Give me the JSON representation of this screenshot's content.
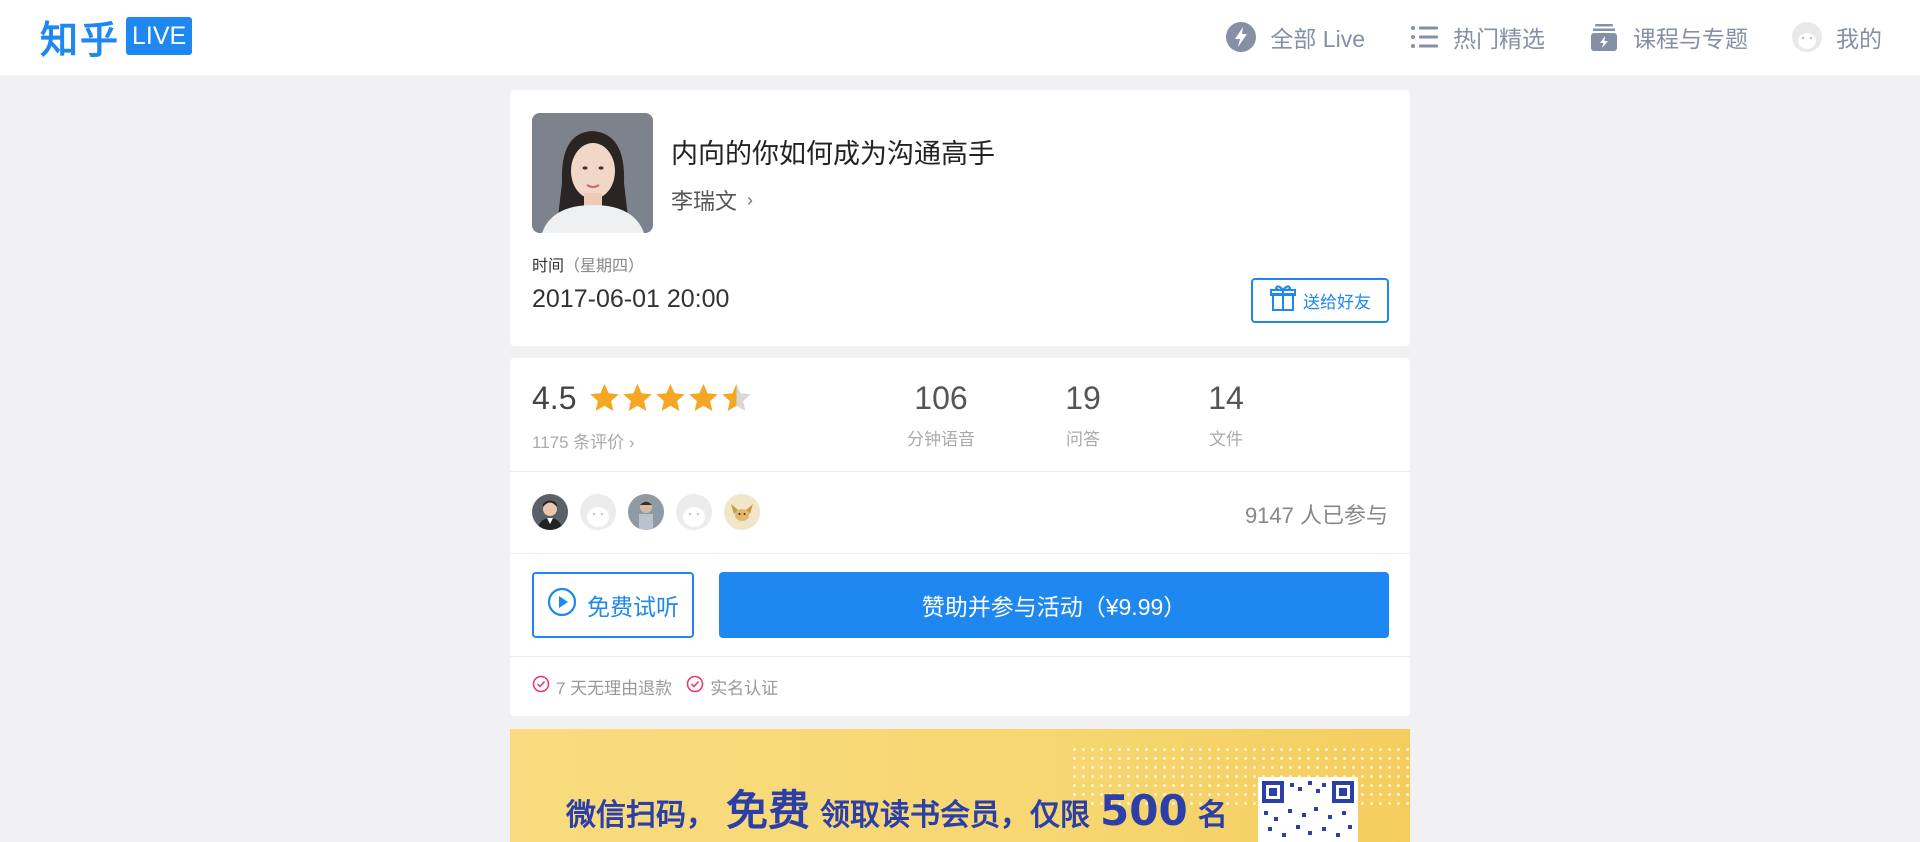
{
  "header": {
    "logo_text": "知乎",
    "logo_badge": "LIVE",
    "nav": [
      {
        "label": "全部 Live",
        "icon": "lightning-icon"
      },
      {
        "label": "热门精选",
        "icon": "list-icon"
      },
      {
        "label": "课程与专题",
        "icon": "stack-icon"
      },
      {
        "label": "我的",
        "icon": "avatar-icon"
      }
    ]
  },
  "live": {
    "title": "内向的你如何成为沟通高手",
    "speaker": "李瑞文",
    "time_label": "时间",
    "weekday": "（星期四）",
    "time_value": "2017-06-01 20:00",
    "gift_label": "送给好友"
  },
  "stats": {
    "rating": "4.5",
    "rating_value": 4.5,
    "rating_max": 5,
    "review_count": "1175 条评价",
    "items": [
      {
        "value": "106",
        "label": "分钟语音"
      },
      {
        "value": "19",
        "label": "问答"
      },
      {
        "value": "14",
        "label": "文件"
      }
    ],
    "participants": "9147 人已参与"
  },
  "actions": {
    "try_label": "免费试听",
    "buy_label": "赞助并参与活动（¥9.99）"
  },
  "badges": [
    "7 天无理由退款",
    "实名认证"
  ],
  "banner": {
    "part1": "微信扫码，",
    "part2": "免费",
    "part3": "领取读书会员，仅限",
    "part4": "500",
    "part5": "名"
  },
  "colors": {
    "accent": "#1e88f0",
    "star": "#f5a623",
    "banner": "#f7d772",
    "banner_text": "#2c3fa8",
    "badge": "#e8356b"
  }
}
